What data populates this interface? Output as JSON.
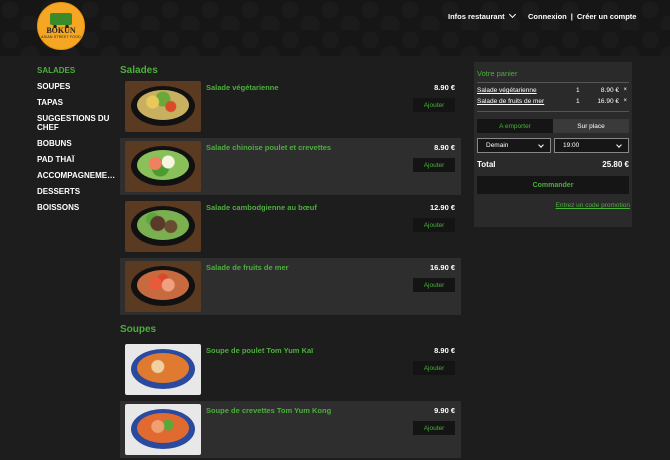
{
  "header": {
    "logo_name": "BOKUN",
    "logo_sub": "ASIAN STREET FOOD",
    "infos": "Infos restaurant",
    "login": "Connexion",
    "separator": "|",
    "signup": "Créer un compte"
  },
  "sidebar": {
    "items": [
      {
        "label": "SALADES"
      },
      {
        "label": "SOUPES"
      },
      {
        "label": "TAPAS"
      },
      {
        "label": "SUGGESTIONS DU CHEF"
      },
      {
        "label": "BOBUNS"
      },
      {
        "label": "PAD THAÏ"
      },
      {
        "label": "ACCOMPAGNEMENTS"
      },
      {
        "label": "DESSERTS"
      },
      {
        "label": "BOISSONS"
      }
    ]
  },
  "menu": {
    "salades": {
      "title": "Salades",
      "items": [
        {
          "name": "Salade végétarienne",
          "price": "8.90 €",
          "button": "Ajouter"
        },
        {
          "name": "Salade chinoise poulet et crevettes",
          "price": "8.90 €",
          "button": "Ajouter"
        },
        {
          "name": "Salade cambodgienne au bœuf",
          "price": "12.90 €",
          "button": "Ajouter"
        },
        {
          "name": "Salade de fruits de mer",
          "price": "16.90 €",
          "button": "Ajouter"
        }
      ]
    },
    "soupes": {
      "title": "Soupes",
      "items": [
        {
          "name": "Soupe de poulet Tom Yum Kaï",
          "price": "8.90 €",
          "button": "Ajouter"
        },
        {
          "name": "Soupe de crevettes Tom Yum Kong",
          "price": "9.90 €",
          "button": "Ajouter"
        }
      ]
    }
  },
  "cart": {
    "title": "Votre panier",
    "items": [
      {
        "name": "Salade végétarienne",
        "qty": "1",
        "price": "8.90 €",
        "remove": "×"
      },
      {
        "name": "Salade de fruits de mer",
        "qty": "1",
        "price": "16.90 €",
        "remove": "×"
      }
    ],
    "mode_takeaway": "A emporter",
    "mode_onsite": "Sur place",
    "day": "Demain",
    "time": "19:00",
    "total_label": "Total",
    "total_value": "25.80 €",
    "order_button": "Commander",
    "promo_link": "Entrez un code promotion"
  },
  "colors": {
    "accent": "#4caf3c",
    "background": "#1d1d1d",
    "logo": "#f5a623"
  }
}
